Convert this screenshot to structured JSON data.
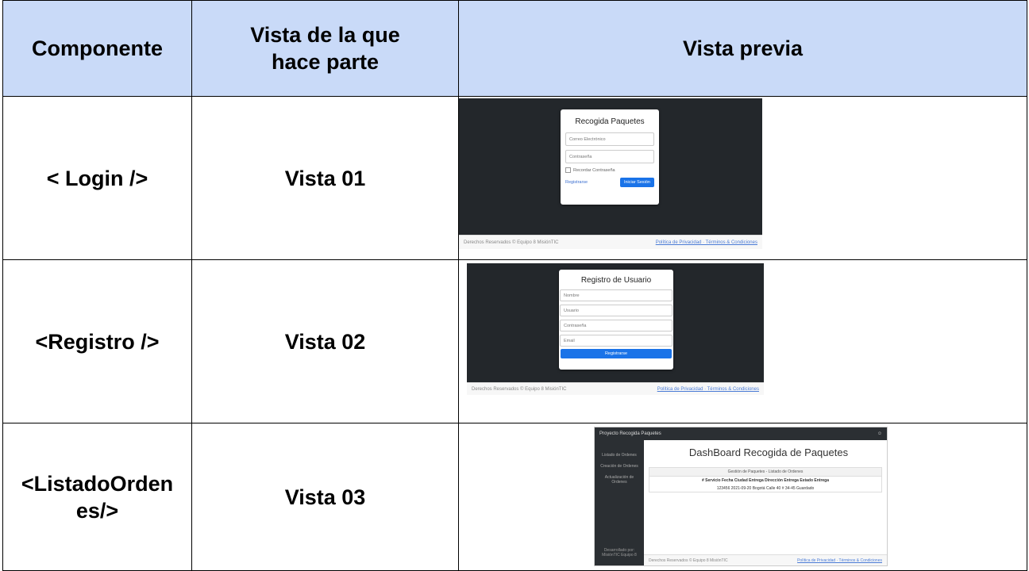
{
  "headers": [
    "Componente",
    "Vista de la que hace parte",
    "Vista previa"
  ],
  "rows": [
    {
      "component": "< Login />",
      "view": "Vista 01"
    },
    {
      "component": "<Registro />",
      "view": "Vista 02"
    },
    {
      "component": "<ListadoOrdenes/>",
      "view": "Vista 03"
    }
  ],
  "login_preview": {
    "title": "Recogida Paquetes",
    "email_placeholder": "Correo Electrónico",
    "password_placeholder": "Contraseña",
    "remember": "Recordar Contraseña",
    "register_link": "Registrarse",
    "login_button": "Iniciar Sesión",
    "footer_left": "Derechos Reservados © Equipo 8 MisiónTIC",
    "footer_right": "Política de Privacidad · Términos & Condiciones"
  },
  "register_preview": {
    "title": "Registro de Usuario",
    "fields": [
      "Nombre",
      "Usuario",
      "Contraseña",
      "Email"
    ],
    "button": "Registrarse",
    "footer_left": "Derechos Reservados © Equipo 8 MisiónTIC",
    "footer_right": "Política de Privacidad · Términos & Condiciones"
  },
  "dashboard_preview": {
    "brand": "Proyecto Recogida Paquetes",
    "sidebar": [
      "Listado de Ordenes",
      "Creación de Ordenes",
      "Actualización de Ordenes"
    ],
    "sidebar_footer": "Desarrollado por: MisiónTIC Equipo 8",
    "heading": "DashBoard Recogida de Paquetes",
    "panel_title": "Gestión de Paquetes - Listado de Ordenes",
    "table_header": "# Servicio  Fecha   Ciudad Entrega  Dirección Entrega  Estado Entrega",
    "table_row": "123456   2021-09-20   Bogotá   Calle 40 # 34-45   Guardado",
    "footer_left": "Derechos Reservados © Equipo 8 MisiónTIC",
    "footer_right": "Política de Privacidad · Términos & Condiciones"
  }
}
